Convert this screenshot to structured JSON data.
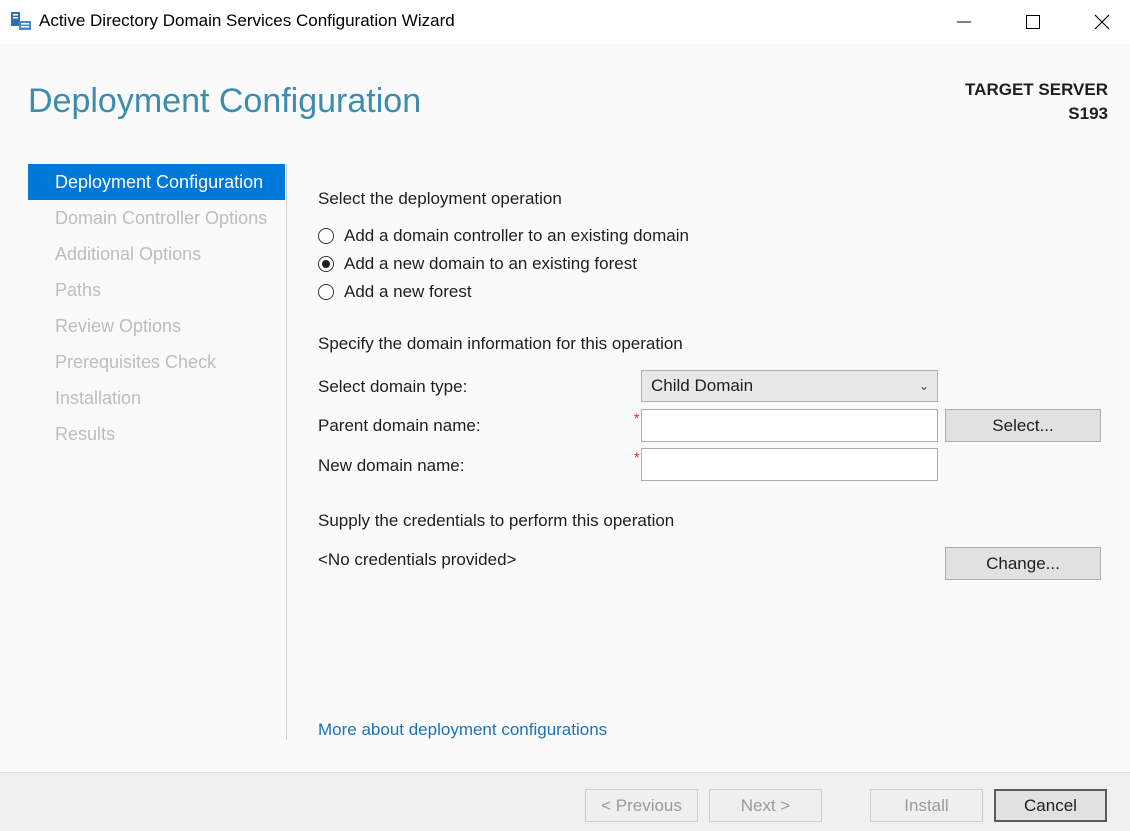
{
  "window": {
    "title": "Active Directory Domain Services Configuration Wizard",
    "icon": "ad-ds-server-icon",
    "controls": {
      "minimize": "minimize-icon",
      "maximize": "maximize-icon",
      "close": "close-icon"
    }
  },
  "header": {
    "page_title": "Deployment Configuration",
    "target_server_label": "TARGET SERVER",
    "target_server_name": "S193"
  },
  "nav": {
    "items": [
      {
        "label": "Deployment Configuration",
        "active": true
      },
      {
        "label": "Domain Controller Options",
        "active": false
      },
      {
        "label": "Additional Options",
        "active": false
      },
      {
        "label": "Paths",
        "active": false
      },
      {
        "label": "Review Options",
        "active": false
      },
      {
        "label": "Prerequisites Check",
        "active": false
      },
      {
        "label": "Installation",
        "active": false
      },
      {
        "label": "Results",
        "active": false
      }
    ]
  },
  "main": {
    "operation_heading": "Select the deployment operation",
    "operations": [
      {
        "label": "Add a domain controller to an existing domain",
        "checked": false
      },
      {
        "label": "Add a new domain to an existing forest",
        "checked": true
      },
      {
        "label": "Add a new forest",
        "checked": false
      }
    ],
    "domain_info_heading": "Specify the domain information for this operation",
    "domain_type_label": "Select domain type:",
    "domain_type_value": "Child Domain",
    "parent_domain_label": "Parent domain name:",
    "parent_domain_value": "",
    "new_domain_label": "New domain name:",
    "new_domain_value": "",
    "required_marker": "*",
    "select_button": "Select...",
    "credentials_heading": "Supply the credentials to perform this operation",
    "credentials_value": "<No credentials provided>",
    "change_button": "Change...",
    "more_link": "More about deployment configurations"
  },
  "footer": {
    "previous": "< Previous",
    "next": "Next >",
    "install": "Install",
    "cancel": "Cancel"
  },
  "colors": {
    "title_accent": "#3c8cad",
    "nav_active_bg": "#0078d7",
    "link": "#1a73b8",
    "required": "#e22222"
  }
}
